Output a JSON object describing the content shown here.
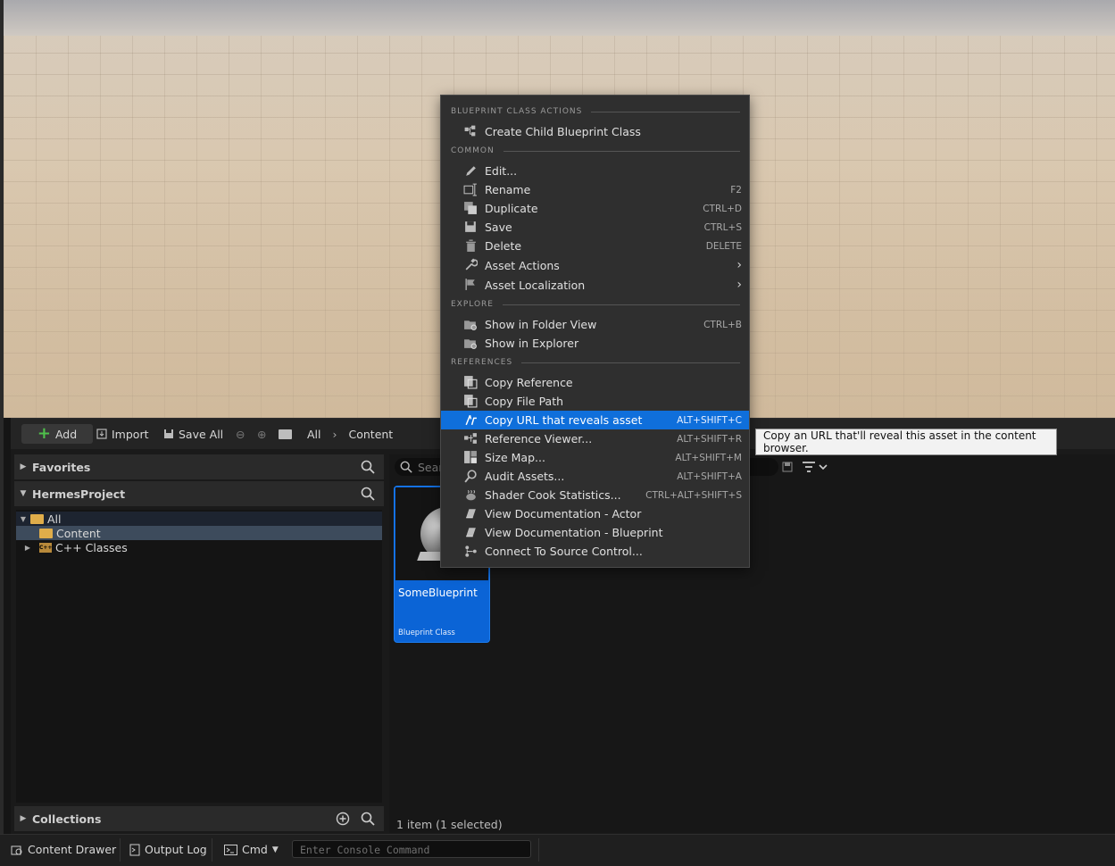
{
  "toolbar": {
    "add_label": "Add",
    "import_label": "Import",
    "save_all_label": "Save All",
    "breadcrumb": [
      "All",
      "Content"
    ]
  },
  "sidebar": {
    "favorites_label": "Favorites",
    "project_label": "HermesProject",
    "tree": [
      {
        "label": "All"
      },
      {
        "label": "Content"
      },
      {
        "label": "C++ Classes"
      }
    ],
    "collections_label": "Collections"
  },
  "assets": {
    "search_placeholder": "Sear",
    "tile": {
      "name": "SomeBlueprint",
      "type": "Blueprint Class"
    },
    "status": "1 item (1 selected)"
  },
  "context_menu": {
    "sections": [
      {
        "title": "BLUEPRINT CLASS ACTIONS",
        "items": [
          {
            "icon": "child-blueprint-icon",
            "label": "Create Child Blueprint Class",
            "shortcut": ""
          }
        ]
      },
      {
        "title": "COMMON",
        "items": [
          {
            "icon": "pencil-icon",
            "label": "Edit...",
            "shortcut": ""
          },
          {
            "icon": "rename-icon",
            "label": "Rename",
            "shortcut": "F2"
          },
          {
            "icon": "duplicate-icon",
            "label": "Duplicate",
            "shortcut": "CTRL+D"
          },
          {
            "icon": "save-icon",
            "label": "Save",
            "shortcut": "CTRL+S"
          },
          {
            "icon": "trash-icon",
            "label": "Delete",
            "shortcut": "DELETE"
          },
          {
            "icon": "wrench-icon",
            "label": "Asset Actions",
            "shortcut": "",
            "submenu": true
          },
          {
            "icon": "flag-icon",
            "label": "Asset Localization",
            "shortcut": "",
            "submenu": true
          }
        ]
      },
      {
        "title": "EXPLORE",
        "items": [
          {
            "icon": "folder-search-icon",
            "label": "Show in Folder View",
            "shortcut": "CTRL+B"
          },
          {
            "icon": "folder-search-icon",
            "label": "Show in Explorer",
            "shortcut": ""
          }
        ]
      },
      {
        "title": "REFERENCES",
        "items": [
          {
            "icon": "copy-icon",
            "label": "Copy Reference",
            "shortcut": ""
          },
          {
            "icon": "copy-icon",
            "label": "Copy File Path",
            "shortcut": ""
          },
          {
            "icon": "link-icon",
            "label": "Copy URL that reveals asset",
            "shortcut": "ALT+SHIFT+C",
            "highlighted": true
          },
          {
            "icon": "reference-viewer-icon",
            "label": "Reference Viewer...",
            "shortcut": "ALT+SHIFT+R"
          },
          {
            "icon": "size-map-icon",
            "label": "Size Map...",
            "shortcut": "ALT+SHIFT+M"
          },
          {
            "icon": "audit-icon",
            "label": "Audit Assets...",
            "shortcut": "ALT+SHIFT+A"
          },
          {
            "icon": "teapot-icon",
            "label": "Shader Cook Statistics...",
            "shortcut": "CTRL+ALT+SHIFT+S"
          },
          {
            "icon": "book-icon",
            "label": "View Documentation - Actor",
            "shortcut": ""
          },
          {
            "icon": "book-icon",
            "label": "View Documentation - Blueprint",
            "shortcut": ""
          },
          {
            "icon": "source-control-icon",
            "label": "Connect To Source Control...",
            "shortcut": ""
          }
        ]
      }
    ]
  },
  "tooltip": "Copy an URL that'll reveal this asset in the content browser.",
  "bottombar": {
    "content_drawer": "Content Drawer",
    "output_log": "Output Log",
    "cmd": "Cmd",
    "console_placeholder": "Enter Console Command"
  },
  "colors": {
    "highlight": "#0f6fdb",
    "selection_tile": "#0b64d6",
    "add_plus": "#4fc14b"
  }
}
